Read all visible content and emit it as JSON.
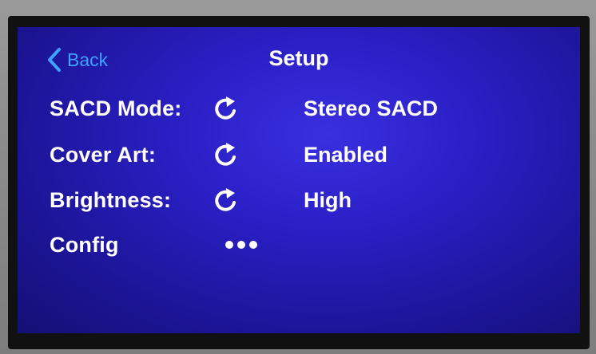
{
  "header": {
    "back_label": "Back",
    "title": "Setup"
  },
  "settings": [
    {
      "label": "SACD Mode:",
      "icon": "cycle-arrow-icon",
      "value": "Stereo SACD"
    },
    {
      "label": "Cover Art:",
      "icon": "cycle-arrow-icon",
      "value": "Enabled"
    },
    {
      "label": "Brightness:",
      "icon": "cycle-arrow-icon",
      "value": "High"
    },
    {
      "label": "Config",
      "icon": "more-dots-icon",
      "value": ""
    }
  ],
  "colors": {
    "screen_blue": "#2a1fc4",
    "accent": "#3ea2ff",
    "text": "#ffffff"
  }
}
